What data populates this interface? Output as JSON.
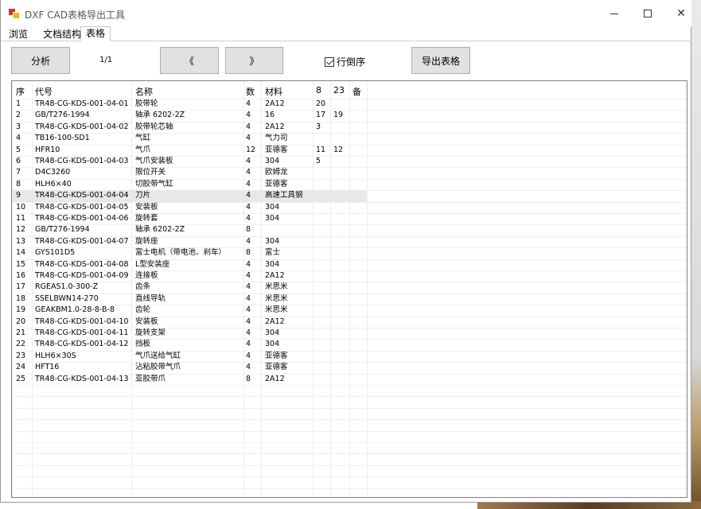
{
  "window": {
    "title": "DXF CAD表格导出工具"
  },
  "tabs": [
    {
      "label": "浏览"
    },
    {
      "label": "文档结构"
    },
    {
      "label": "表格"
    }
  ],
  "toolbar": {
    "analyze_label": "分析",
    "page_indicator": "1/1",
    "prev_label": "《",
    "next_label": "》",
    "reverse_label": "行倒序",
    "reverse_checked": true,
    "export_label": "导出表格"
  },
  "table": {
    "headers": [
      "序",
      "代号",
      "名称",
      "数",
      "材料",
      "8",
      "23",
      "备"
    ],
    "rows": [
      [
        "1",
        "TR48-CG-KDS-001-04-01",
        "胶带轮",
        "4",
        "2A12",
        "20",
        "",
        ""
      ],
      [
        "2",
        "GB/T276-1994",
        "轴承 6202-2Z",
        "4",
        "16",
        "17",
        "19",
        ""
      ],
      [
        "3",
        "TR48-CG-KDS-001-04-02",
        "胶带轮芯轴",
        "4",
        "2A12",
        "3",
        "",
        ""
      ],
      [
        "4",
        "TB16-100-SD1",
        "气缸",
        "4",
        "气力司",
        "",
        "",
        ""
      ],
      [
        "5",
        "HFR10",
        "气爪",
        "12",
        "亚德客",
        "11",
        "12",
        ""
      ],
      [
        "6",
        "TR48-CG-KDS-001-04-03",
        "气爪安装板",
        "4",
        "304",
        "5",
        "",
        ""
      ],
      [
        "7",
        "D4C3260",
        "限位开关",
        "4",
        "欧姆龙",
        "",
        "",
        ""
      ],
      [
        "8",
        "HLH6×40",
        "切胶带气缸",
        "4",
        "亚德客",
        "",
        "",
        ""
      ],
      [
        "9",
        "TR48-CG-KDS-001-04-04",
        "刀片",
        "4",
        "高速工具钢",
        "",
        "",
        ""
      ],
      [
        "10",
        "TR48-CG-KDS-001-04-05",
        "安装板",
        "4",
        "304",
        "",
        "",
        ""
      ],
      [
        "11",
        "TR48-CG-KDS-001-04-06",
        "旋转套",
        "4",
        "304",
        "",
        "",
        ""
      ],
      [
        "12",
        "GB/T276-1994",
        "轴承 6202-2Z",
        "8",
        "",
        "",
        "",
        ""
      ],
      [
        "13",
        "TR48-CG-KDS-001-04-07",
        "旋转座",
        "4",
        "304",
        "",
        "",
        ""
      ],
      [
        "14",
        "GYS101D5",
        "富士电机（带电池、刹车）",
        "8",
        "富士",
        "",
        "",
        ""
      ],
      [
        "15",
        "TR48-CG-KDS-001-04-08",
        "L型安装座",
        "4",
        "304",
        "",
        "",
        ""
      ],
      [
        "16",
        "TR48-CG-KDS-001-04-09",
        "连接板",
        "4",
        "2A12",
        "",
        "",
        ""
      ],
      [
        "17",
        "RGEAS1.0-300-Z",
        "齿条",
        "4",
        "米思米",
        "",
        "",
        ""
      ],
      [
        "18",
        "SSELBWN14-270",
        "直线导轨",
        "4",
        "米思米",
        "",
        "",
        ""
      ],
      [
        "19",
        "GEAKBM1.0-28-8-B-8",
        "齿轮",
        "4",
        "米思米",
        "",
        "",
        ""
      ],
      [
        "20",
        "TR48-CG-KDS-001-04-10",
        "安装板",
        "4",
        "2A12",
        "",
        "",
        ""
      ],
      [
        "21",
        "TR48-CG-KDS-001-04-11",
        "旋转支架",
        "4",
        "304",
        "",
        "",
        ""
      ],
      [
        "22",
        "TR48-CG-KDS-001-04-12",
        "挡板",
        "4",
        "304",
        "",
        "",
        ""
      ],
      [
        "23",
        "HLH6×30S",
        "气爪送给气缸",
        "4",
        "亚德客",
        "",
        "",
        ""
      ],
      [
        "24",
        "HFT16",
        "沾粘胶带气爪",
        "4",
        "亚德客",
        "",
        "",
        ""
      ],
      [
        "25",
        "TR48-CG-KDS-001-04-13",
        "亚胶带爪",
        "8",
        "2A12",
        "",
        "",
        ""
      ]
    ],
    "selected_row_index": 8
  }
}
